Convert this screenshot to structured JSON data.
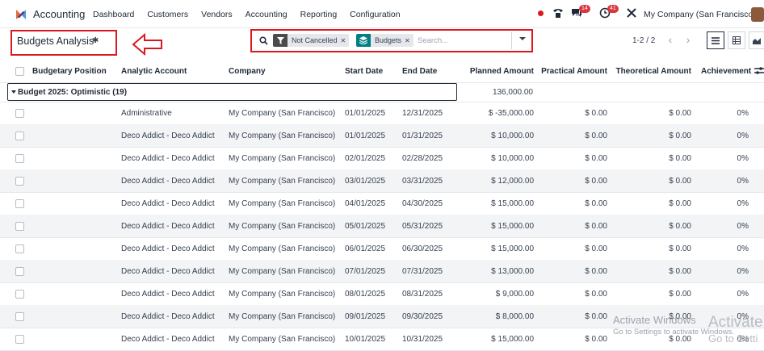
{
  "app": {
    "name": "Accounting"
  },
  "menu": [
    "Dashboard",
    "Customers",
    "Vendors",
    "Accounting",
    "Reporting",
    "Configuration"
  ],
  "systray": {
    "messages_count": "14",
    "activity_count": "41",
    "company": "My Company (San Francisco)"
  },
  "page": {
    "title": "Budgets Analysis"
  },
  "search": {
    "facets": [
      {
        "label": "Not Cancelled",
        "icon": "filter-icon"
      },
      {
        "label": "Budgets",
        "icon": "layers-icon"
      }
    ],
    "placeholder": "Search..."
  },
  "pager": {
    "value": "1-2 / 2"
  },
  "table": {
    "columns": [
      "Budgetary Position",
      "Analytic Account",
      "Company",
      "Start Date",
      "End Date",
      "Planned Amount",
      "Practical Amount",
      "Theoretical Amount",
      "Achievement"
    ],
    "group": {
      "label": "Budget 2025: Optimistic (19)",
      "total": "136,000.00"
    },
    "rows": [
      [
        "",
        "Administrative",
        "My Company (San Francisco)",
        "01/01/2025",
        "12/31/2025",
        "$ -35,000.00",
        "$ 0.00",
        "$ 0.00",
        "0%"
      ],
      [
        "",
        "Deco Addict - Deco Addict",
        "My Company (San Francisco)",
        "01/01/2025",
        "01/31/2025",
        "$ 10,000.00",
        "$ 0.00",
        "$ 0.00",
        "0%"
      ],
      [
        "",
        "Deco Addict - Deco Addict",
        "My Company (San Francisco)",
        "02/01/2025",
        "02/28/2025",
        "$ 10,000.00",
        "$ 0.00",
        "$ 0.00",
        "0%"
      ],
      [
        "",
        "Deco Addict - Deco Addict",
        "My Company (San Francisco)",
        "03/01/2025",
        "03/31/2025",
        "$ 12,000.00",
        "$ 0.00",
        "$ 0.00",
        "0%"
      ],
      [
        "",
        "Deco Addict - Deco Addict",
        "My Company (San Francisco)",
        "04/01/2025",
        "04/30/2025",
        "$ 15,000.00",
        "$ 0.00",
        "$ 0.00",
        "0%"
      ],
      [
        "",
        "Deco Addict - Deco Addict",
        "My Company (San Francisco)",
        "05/01/2025",
        "05/31/2025",
        "$ 15,000.00",
        "$ 0.00",
        "$ 0.00",
        "0%"
      ],
      [
        "",
        "Deco Addict - Deco Addict",
        "My Company (San Francisco)",
        "06/01/2025",
        "06/30/2025",
        "$ 15,000.00",
        "$ 0.00",
        "$ 0.00",
        "0%"
      ],
      [
        "",
        "Deco Addict - Deco Addict",
        "My Company (San Francisco)",
        "07/01/2025",
        "07/31/2025",
        "$ 13,000.00",
        "$ 0.00",
        "$ 0.00",
        "0%"
      ],
      [
        "",
        "Deco Addict - Deco Addict",
        "My Company (San Francisco)",
        "08/01/2025",
        "08/31/2025",
        "$ 9,000.00",
        "$ 0.00",
        "$ 0.00",
        "0%"
      ],
      [
        "",
        "Deco Addict - Deco Addict",
        "My Company (San Francisco)",
        "09/01/2025",
        "09/30/2025",
        "$ 8,000.00",
        "$ 0.00",
        "$ 0.00",
        "0%"
      ],
      [
        "",
        "Deco Addict - Deco Addict",
        "My Company (San Francisco)",
        "10/01/2025",
        "10/31/2025",
        "$ 15,000.00",
        "$ 0.00",
        "$ 0.00",
        "0%"
      ]
    ]
  },
  "watermark": {
    "line1": "Activate Windows",
    "line2": "Go to Settings to activate Windows.",
    "line1_dup": "Activate",
    "line2_dup": "Go to Setti"
  },
  "colors": {
    "annotation": "#d71920",
    "filter_facet": "#4b4b4b",
    "group_facet": "#017e84"
  }
}
